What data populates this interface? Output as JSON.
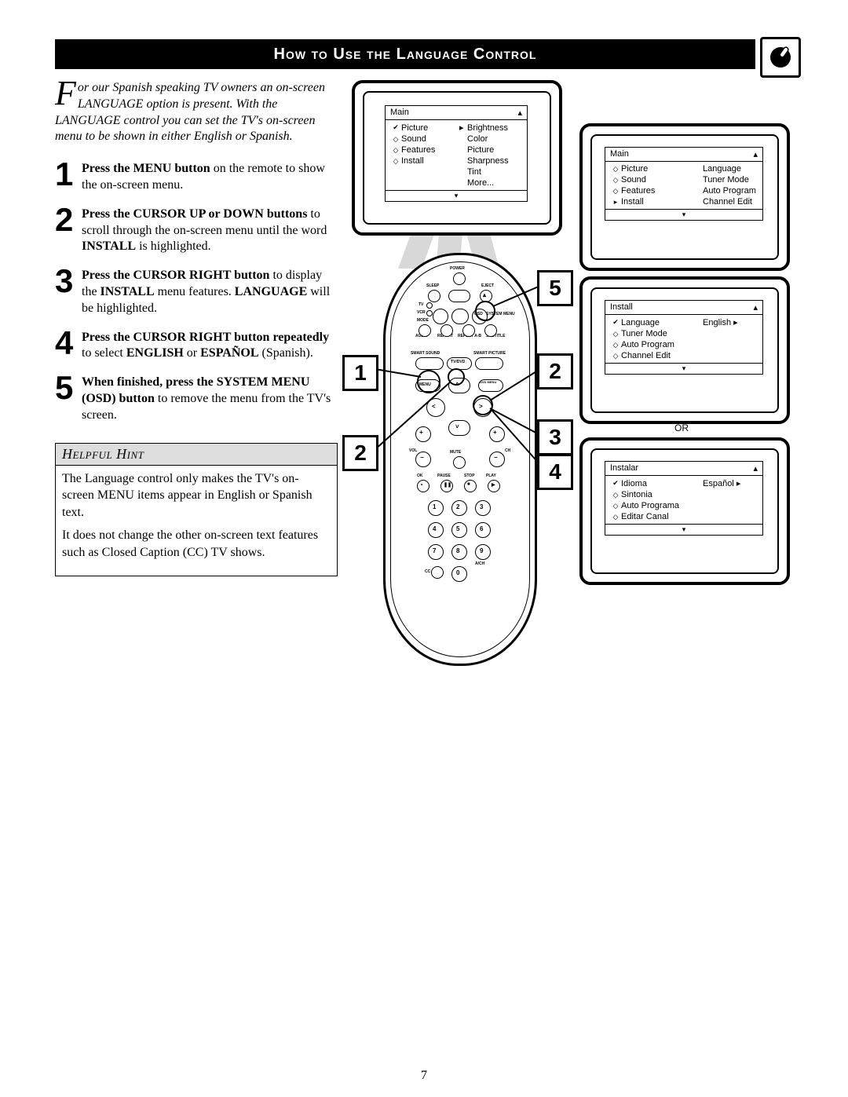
{
  "header": {
    "title": "How to Use the Language Control"
  },
  "intro": {
    "dropcap": "F",
    "text": "or our Spanish speaking TV owners an on-screen LANGUAGE option is present. With the LANGUAGE control you can set the TV's on-screen menu to be shown in either English or Spanish."
  },
  "steps": [
    {
      "num": "1",
      "bold": "Press the MENU button",
      "rest": " on the remote to show the on-screen menu."
    },
    {
      "num": "2",
      "bold": "Press the CURSOR UP or DOWN buttons",
      "rest": " to scroll through the on-screen menu until the word ",
      "bold2": "INSTALL",
      "rest2": " is highlighted."
    },
    {
      "num": "3",
      "bold": "Press the CURSOR RIGHT button",
      "rest": " to display the ",
      "bold2": "INSTALL",
      "rest2": " menu features. ",
      "bold3": "LANGUAGE",
      "rest3": " will be highlighted."
    },
    {
      "num": "4",
      "bold": "Press the CURSOR RIGHT button repeatedly",
      "rest": " to select ",
      "bold2": "ENGLISH",
      "rest2": " or ",
      "bold3": "ESPAÑOL",
      "rest3": " (Spanish)."
    },
    {
      "num": "5",
      "bold": "When finished, press the SYSTEM MENU (OSD) button",
      "rest": " to remove the menu from the TV's screen."
    }
  ],
  "hint": {
    "title": "Helpful Hint",
    "p1": "The Language control only makes the TV's on-screen MENU items appear in English or Spanish text.",
    "p2": "It does not change the other on-screen text features such as Closed Caption (CC) TV shows."
  },
  "menus": {
    "tv1": {
      "header": "Main",
      "items": [
        {
          "sym": "✔",
          "lbl": "Picture",
          "arrow": "▸",
          "val": "Brightness"
        },
        {
          "sym": "◇",
          "lbl": "Sound",
          "val": "Color"
        },
        {
          "sym": "◇",
          "lbl": "Features",
          "val": "Picture"
        },
        {
          "sym": "◇",
          "lbl": "Install",
          "val": "Sharpness"
        },
        {
          "sym": "",
          "lbl": "",
          "val": "Tint"
        },
        {
          "sym": "",
          "lbl": "",
          "val": "More..."
        }
      ]
    },
    "tv2": {
      "header": "Main",
      "items": [
        {
          "sym": "◇",
          "lbl": "Picture",
          "val": "Language"
        },
        {
          "sym": "◇",
          "lbl": "Sound",
          "val": "Tuner Mode"
        },
        {
          "sym": "◇",
          "lbl": "Features",
          "val": "Auto Program"
        },
        {
          "sym": "▸",
          "lbl": "Install",
          "val": "Channel Edit"
        }
      ]
    },
    "tv3": {
      "header": "Install",
      "items": [
        {
          "sym": "✔",
          "lbl": "Language",
          "val": "English",
          "arrow": "▸"
        },
        {
          "sym": "◇",
          "lbl": "Tuner Mode",
          "val": ""
        },
        {
          "sym": "◇",
          "lbl": "Auto Program",
          "val": ""
        },
        {
          "sym": "◇",
          "lbl": "Channel Edit",
          "val": ""
        }
      ]
    },
    "tv4": {
      "header": "Instalar",
      "items": [
        {
          "sym": "✔",
          "lbl": "Idioma",
          "val": "Español",
          "arrow": "▸"
        },
        {
          "sym": "◇",
          "lbl": "Sintonia",
          "val": ""
        },
        {
          "sym": "◇",
          "lbl": "Auto Programa",
          "val": ""
        },
        {
          "sym": "◇",
          "lbl": "Editar Canal",
          "val": ""
        }
      ]
    },
    "or": "OR"
  },
  "remote": {
    "labels": {
      "power": "POWER",
      "sleep": "SLEEP",
      "eject": "EJECT",
      "tv": "TV",
      "vcr": "VCR",
      "mode": "MODE",
      "sysmenu": "SYSTEM MENU",
      "audio": "AUDIO",
      "repeat": "REPEAT",
      "repeatab": "REPEAT A-B",
      "subtitle": "SUBTITLE",
      "smartsound": "SMART SOUND",
      "smartpicture": "SMART PICTURE",
      "tvdvd": "TV/DVD",
      "menu": "MENU",
      "dvdmenu": "DVD MENU",
      "vol": "VOL",
      "ch": "CH",
      "mute": "MUTE",
      "ok": "OK",
      "pause": "PAUSE",
      "stop": "STOP",
      "play": "PLAY",
      "cc": "CC",
      "air": "A/CH"
    },
    "numbers": [
      "1",
      "2",
      "3",
      "4",
      "5",
      "6",
      "7",
      "8",
      "9",
      "0"
    ]
  },
  "callouts": {
    "c1": "1",
    "c2a": "2",
    "c2b": "2",
    "c3": "3",
    "c4": "4",
    "c5": "5"
  },
  "page_number": "7"
}
